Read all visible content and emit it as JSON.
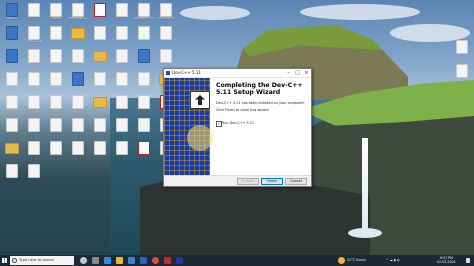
{
  "desktop_icons": [
    {
      "label": "zenbOS",
      "glyph": "g-app"
    },
    {
      "label": "",
      "glyph": "g-file"
    },
    {
      "label": "Studio",
      "glyph": "g-file"
    },
    {
      "label": "Rendergit2022",
      "glyph": "g-file"
    },
    {
      "label": "",
      "glyph": "g-red"
    },
    {
      "label": "",
      "glyph": "g-file"
    },
    {
      "label": "RenameSRM",
      "glyph": "g-file"
    },
    {
      "label": "Calendar Hi",
      "glyph": "g-file"
    },
    {
      "label": "",
      "glyph": "g-app"
    },
    {
      "label": "Tisk2022N",
      "glyph": "g-file"
    },
    {
      "label": "",
      "glyph": "g-file"
    },
    {
      "label": "",
      "glyph": "g-folder"
    },
    {
      "label": "",
      "glyph": "g-file"
    },
    {
      "label": "",
      "glyph": "g-file"
    },
    {
      "label": "",
      "glyph": "g-file"
    },
    {
      "label": "",
      "glyph": "g-file"
    },
    {
      "label": "",
      "glyph": "g-app"
    },
    {
      "label": "",
      "glyph": "g-file"
    },
    {
      "label": "",
      "glyph": "g-file"
    },
    {
      "label": "",
      "glyph": "g-file"
    },
    {
      "label": "",
      "glyph": "g-folder"
    },
    {
      "label": "",
      "glyph": "g-file"
    },
    {
      "label": "",
      "glyph": "g-app"
    },
    {
      "label": "",
      "glyph": "g-file"
    },
    {
      "label": "",
      "glyph": "g-file"
    },
    {
      "label": "",
      "glyph": "g-file"
    },
    {
      "label": "",
      "glyph": "g-file"
    },
    {
      "label": "",
      "glyph": "g-app"
    },
    {
      "label": "",
      "glyph": "g-file"
    },
    {
      "label": "",
      "glyph": "g-file"
    },
    {
      "label": "",
      "glyph": "g-file"
    },
    {
      "label": "",
      "glyph": "g-folder"
    },
    {
      "label": "",
      "glyph": "g-file"
    },
    {
      "label": "",
      "glyph": "g-file"
    },
    {
      "label": "",
      "glyph": "g-file"
    },
    {
      "label": "",
      "glyph": "g-file"
    },
    {
      "label": "",
      "glyph": "g-folder"
    },
    {
      "label": "",
      "glyph": "g-file"
    },
    {
      "label": "",
      "glyph": "g-file"
    },
    {
      "label": "",
      "glyph": "g-red"
    },
    {
      "label": "",
      "glyph": "g-file"
    },
    {
      "label": "",
      "glyph": "g-file"
    },
    {
      "label": "",
      "glyph": "g-file"
    },
    {
      "label": "",
      "glyph": "g-file"
    },
    {
      "label": "",
      "glyph": "g-file"
    },
    {
      "label": "",
      "glyph": "g-file"
    },
    {
      "label": "",
      "glyph": "g-file"
    },
    {
      "label": "",
      "glyph": "g-file"
    },
    {
      "label": "",
      "glyph": "g-folder"
    },
    {
      "label": "",
      "glyph": "g-file"
    },
    {
      "label": "",
      "glyph": "g-file"
    },
    {
      "label": "",
      "glyph": "g-file"
    },
    {
      "label": "",
      "glyph": "g-file"
    },
    {
      "label": "",
      "glyph": "g-file"
    },
    {
      "label": "",
      "glyph": "g-red"
    },
    {
      "label": "",
      "glyph": "g-file"
    },
    {
      "label": "",
      "glyph": "g-file"
    },
    {
      "label": "",
      "glyph": "g-file"
    }
  ],
  "right_icons": [
    {
      "label": "",
      "glyph": "g-file"
    },
    {
      "label": "",
      "glyph": "g-file"
    }
  ],
  "dialog": {
    "title": "Dev-C++ 5.11",
    "heading": "Completing the Dev-C++ 5.11 Setup Wizard",
    "line1": "Dev-C++ 5.11 has been installed on your computer.",
    "line2": "Click Finish to close this wizard.",
    "checkbox_label": "Run Dev-C++ 5.11",
    "checkbox_checked": true,
    "back_label": "< Back",
    "finish_label": "Finish",
    "cancel_label": "Cancel"
  },
  "taskbar": {
    "search_placeholder": "Type here to search",
    "weather": "21°C Sunny",
    "time": "9:57 PM",
    "date": "02-02-2024"
  }
}
